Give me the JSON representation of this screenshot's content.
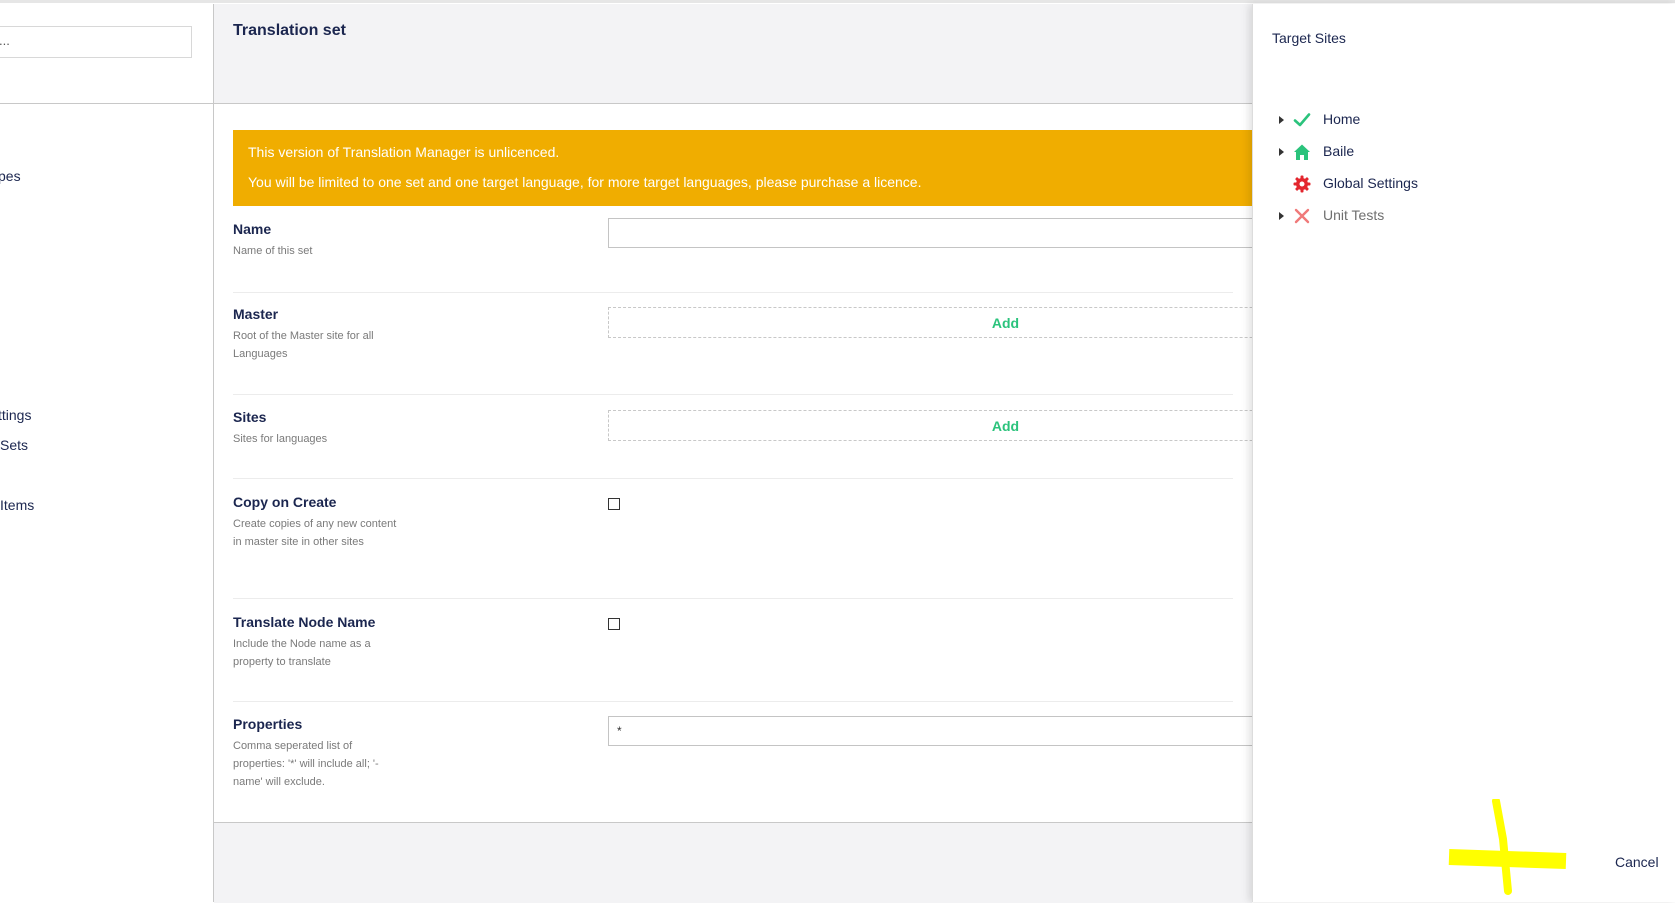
{
  "sidebar": {
    "search_text": "...",
    "items": [
      {
        "label": "pes"
      },
      {
        "label": "ttings"
      },
      {
        "label": "Sets"
      },
      {
        "label": "Items"
      }
    ]
  },
  "editor": {
    "title": "Translation set",
    "banner": {
      "line1": "This version of Translation Manager is unlicenced.",
      "line2": "You will be limited to one set and one target language, for more target languages, please purchase a licence."
    },
    "properties": {
      "name": {
        "label": "Name",
        "description": "Name of this set",
        "value": ""
      },
      "master": {
        "label": "Master",
        "description": "Root of the Master site for all Languages",
        "add_label": "Add"
      },
      "sites": {
        "label": "Sites",
        "description": "Sites for languages",
        "add_label": "Add"
      },
      "copy_on_create": {
        "label": "Copy on Create",
        "description": "Create copies of any new content in master site in other sites",
        "checked": false
      },
      "translate_node_name": {
        "label": "Translate Node Name",
        "description": "Include the Node name as a property to translate",
        "checked": false
      },
      "properties": {
        "label": "Properties",
        "description": "Comma seperated list of properties: '*' will include all; '-name' will exclude.",
        "value": "*"
      }
    }
  },
  "target_sites": {
    "title": "Target Sites",
    "items": [
      {
        "label": "Home",
        "icon": "check-icon",
        "color": "#2bc37c",
        "expandable": true
      },
      {
        "label": "Baile",
        "icon": "home-icon",
        "color": "#2bc37c",
        "expandable": true
      },
      {
        "label": "Global Settings",
        "icon": "gear-icon",
        "color": "#e3262e",
        "expandable": false
      },
      {
        "label": "Unit Tests",
        "icon": "tools-icon",
        "color": "#f07a7a",
        "expandable": true
      }
    ],
    "cancel_label": "Cancel"
  },
  "colors": {
    "banner": "#f0ad00",
    "accent_green": "#2bc37c",
    "annotation": "#ffff00"
  }
}
